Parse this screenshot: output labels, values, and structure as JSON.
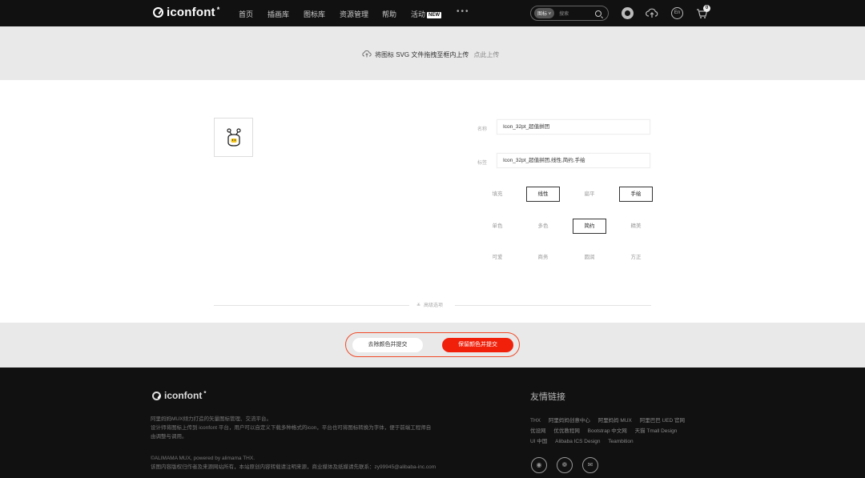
{
  "nav": {
    "logo": "iconfont",
    "logo_star": "*",
    "items": [
      "首页",
      "插画库",
      "图标库",
      "资源管理",
      "帮助",
      "活动"
    ],
    "new_badge": "NEW",
    "more": "•••",
    "search_select": "图标 ˅",
    "search_placeholder": "搜索",
    "lang": "En",
    "cart_count": "0"
  },
  "upload": {
    "text": "将图标 SVG 文件拖拽至框内上传",
    "link": "点此上传"
  },
  "form": {
    "name_label": "名称",
    "name_value": "Icon_32pt_超值拼团",
    "tags_label": "标签",
    "tags_value": "Icon_32pt_超值拼团,线性,简约,手绘",
    "style_tags": [
      {
        "label": "填充",
        "active": false
      },
      {
        "label": "线性",
        "active": true
      },
      {
        "label": "扁平",
        "active": false
      },
      {
        "label": "手绘",
        "active": true
      },
      {
        "label": "单色",
        "active": false
      },
      {
        "label": "多色",
        "active": false
      },
      {
        "label": "简约",
        "active": true
      },
      {
        "label": "精美",
        "active": false
      },
      {
        "label": "可爱",
        "active": false
      },
      {
        "label": "商务",
        "active": false
      },
      {
        "label": "圆润",
        "active": false
      },
      {
        "label": "方正",
        "active": false
      }
    ],
    "advanced": "高级选项"
  },
  "submit": {
    "remove_color": "去除颜色并提交",
    "keep_color": "保留颜色并提交"
  },
  "footer": {
    "logo": "iconfont",
    "desc_lines": [
      "阿里妈妈MUX倾力打造的矢量图标管理、交流平台。",
      "设计师将图标上传到 iconfont 平台，用户可以自定义下载多种格式的icon，平台也可将图标转换为字体，便于前端工程师自",
      "由调整与调用。"
    ],
    "copyright_lines": [
      "©ALIMAMA MUX, powered by alimama THX.",
      "该图内容版权归作者及来源网站所有，本站原创内容转载请注明来源，商业媒体及纸媒请先联系：zy99945@alibaba-inc.com"
    ],
    "friends_title": "友情链接",
    "friend_links_rows": [
      [
        "THX",
        "阿里妈妈创意中心",
        "阿里妈妈 MUX",
        "阿里巴巴 UED 官网"
      ],
      [
        "优设网",
        "优优教程网",
        "Bootstrap 中文网",
        "天猫 Tmall Design"
      ],
      [
        "UI 中国",
        "Alibaba ICS Design",
        "Teambition"
      ]
    ]
  }
}
